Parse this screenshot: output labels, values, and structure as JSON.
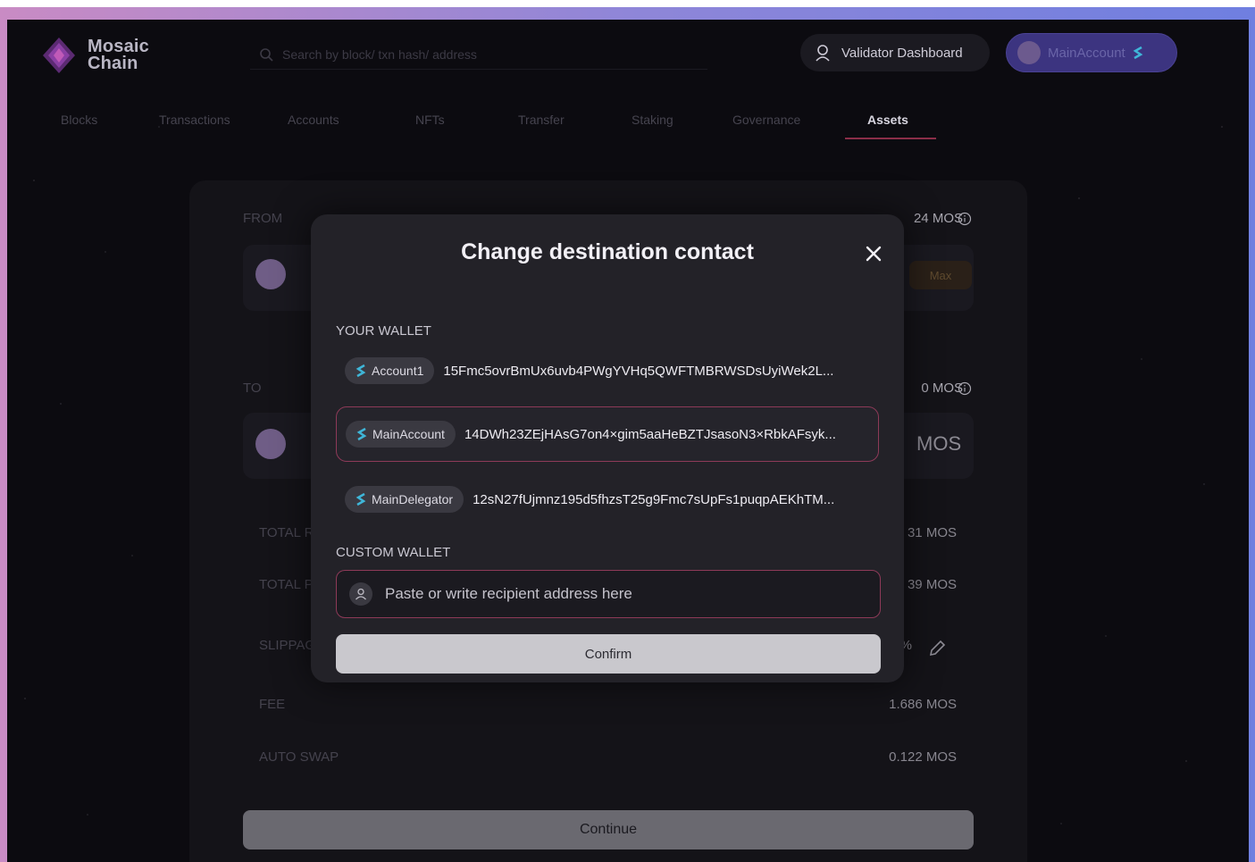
{
  "header": {
    "logo_line1": "Mosaic",
    "logo_line2": "Chain",
    "search_placeholder": "Search by block/ txn hash/ address",
    "validator_label": "Validator Dashboard",
    "account_label": "MainAccount"
  },
  "nav": {
    "items": [
      "Blocks",
      "Transactions",
      "Accounts",
      "NFTs",
      "Transfer",
      "Staking",
      "Governance",
      "Assets"
    ],
    "active": "Assets"
  },
  "background": {
    "from_label": "FROM",
    "from_balance": "24 MOS",
    "max_label": "Max",
    "to_label": "TO",
    "to_balance": "0 MOS",
    "to_currency": "MOS",
    "rows": [
      {
        "label": "TOTAL R",
        "value": "31 MOS"
      },
      {
        "label": "TOTAL P",
        "value": "39 MOS"
      },
      {
        "label": "SLIPPAG",
        "value": "%"
      },
      {
        "label": "FEE",
        "value": "1.686 MOS"
      },
      {
        "label": "AUTO SWAP",
        "value": "0.122 MOS"
      }
    ],
    "continue_label": "Continue"
  },
  "modal": {
    "title": "Change destination contact",
    "your_wallet_label": "YOUR WALLET",
    "wallets": [
      {
        "name": "Account1",
        "address": "15Fmc5ovrBmUx6uvb4PWgYVHq5QWFTMBRWSDsUyiWek2L..."
      },
      {
        "name": "MainAccount",
        "address": "14DWh23ZEjHAsG7on4×gim5aaHeBZTJsasoN3×RbkAFsyk..."
      },
      {
        "name": "MainDelegator",
        "address": "12sN27fUjmnz195d5fhzsT25g9Fmc7sUpFs1puqpAEKhTM..."
      }
    ],
    "selected_wallet": "MainAccount",
    "custom_wallet_label": "CUSTOM WALLET",
    "custom_placeholder": "Paste or write recipient address here",
    "confirm_label": "Confirm"
  },
  "colors": {
    "accent_border": "#8d3a58",
    "account_button": "#3c3480",
    "brand_gradient_start": "#c98bc4",
    "brand_gradient_end": "#6f7fe0"
  },
  "icons": [
    "logo-mark-icon",
    "search-icon",
    "validator-icon",
    "avatar-icon",
    "s-token-icon",
    "close-icon",
    "user-icon",
    "pencil-icon",
    "info-icon"
  ]
}
